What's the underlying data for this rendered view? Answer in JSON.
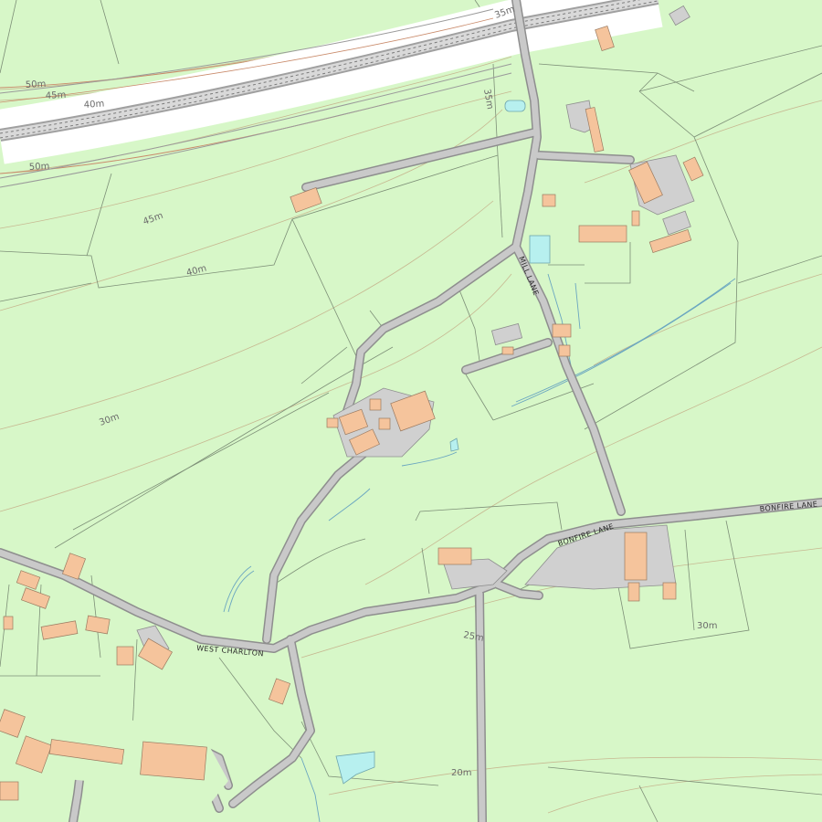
{
  "colors": {
    "land": "#d7f7c8",
    "road_fill": "#c9c9c9",
    "road_edge": "#8e8e8e",
    "building": "#f5c49c",
    "building_edge": "#9a7a60",
    "water": "#b7f0ef",
    "field_line": "#7d8f77",
    "contour": "#c7b891",
    "contour_index": "#c98a6a",
    "yard": "#d0d0d0"
  },
  "road_labels": {
    "west_charlton": "WEST  CHARLTON",
    "bonfire_lane_1": "BONFIRE  LANE",
    "bonfire_lane_2": "BONFIRE LANE",
    "mill_lane": "MILL LANE"
  },
  "contour_labels": {
    "c50_a": "50m",
    "c45_a": "45m",
    "c40_a": "40m",
    "c50_b": "50m",
    "c45_b": "45m",
    "c40_b": "40m",
    "c35_a": "35m",
    "c35_b": "35m",
    "c30_a": "30m",
    "c30_b": "30m",
    "c25": "25m",
    "c20": "20m"
  }
}
